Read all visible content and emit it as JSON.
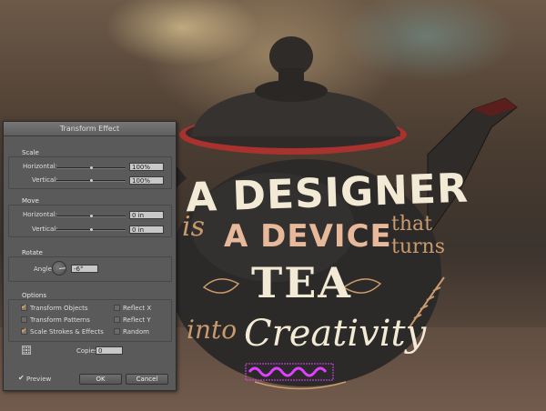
{
  "dialog": {
    "title": "Transform Effect",
    "scale": {
      "label": "Scale",
      "horizontal_label": "Horizontal:",
      "horizontal_value": "100%",
      "horizontal_slider_fraction": 0.5,
      "vertical_label": "Vertical:",
      "vertical_value": "100%",
      "vertical_slider_fraction": 0.5
    },
    "move": {
      "label": "Move",
      "horizontal_label": "Horizontal:",
      "horizontal_value": "0 in",
      "horizontal_slider_fraction": 0.5,
      "vertical_label": "Vertical:",
      "vertical_value": "0 in",
      "vertical_slider_fraction": 0.5
    },
    "rotate": {
      "label": "Rotate",
      "angle_label": "Angle:",
      "angle_value": "-6°"
    },
    "options": {
      "label": "Options",
      "transform_objects": {
        "label": "Transform Objects",
        "checked": true
      },
      "transform_patterns": {
        "label": "Transform Patterns",
        "checked": false
      },
      "scale_strokes": {
        "label": "Scale Strokes & Effects",
        "checked": true
      },
      "reflect_x": {
        "label": "Reflect X",
        "checked": false
      },
      "reflect_y": {
        "label": "Reflect Y",
        "checked": false
      },
      "random": {
        "label": "Random",
        "checked": false
      }
    },
    "copies_label": "Copies",
    "copies_value": "0",
    "preview": {
      "label": "Preview",
      "checked": true
    },
    "ok_label": "OK",
    "cancel_label": "Cancel"
  },
  "artwork": {
    "line1": "A DESIGNER",
    "line2_prefix": "is",
    "line2_main": "A DEVICE",
    "line2_suffix_a": "that",
    "line2_suffix_b": "turns",
    "line3": "TEA",
    "line4_prefix": "into",
    "line4_main": "Creativity"
  },
  "colors": {
    "cream": "#f3ead6",
    "tan": "#c99a6c",
    "peach": "#e7b99a",
    "selection_magenta": "#e040ff",
    "teapot_red_rim": "#a8322e",
    "dialog_bg": "#5a5a5a"
  }
}
